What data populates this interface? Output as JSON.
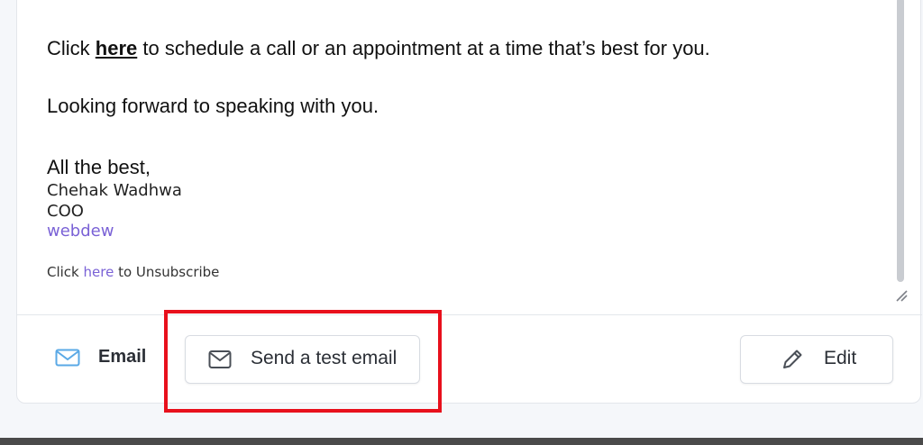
{
  "message": {
    "line1_prefix": "Click ",
    "line1_link": "here",
    "line1_suffix": " to schedule a call or an appointment at a time that’s best for you.",
    "line2": "Looking forward to speaking with you.",
    "closing": "All the best,",
    "signature_name": "Chehak Wadhwa",
    "signature_title": "COO",
    "signature_company": "webdew",
    "unsubscribe_prefix": "Click ",
    "unsubscribe_link": "here",
    "unsubscribe_suffix": " to Unsubscribe"
  },
  "footer": {
    "channel_label": "Email",
    "channel_icon": "envelope-icon",
    "test_button_label": "Send a test email",
    "test_button_icon": "envelope-icon",
    "edit_button_label": "Edit",
    "edit_button_icon": "pencil-icon"
  },
  "colors": {
    "link_purple": "#7a62d6",
    "highlight_red": "#e8101c",
    "email_icon_blue": "#5aa9e6"
  }
}
